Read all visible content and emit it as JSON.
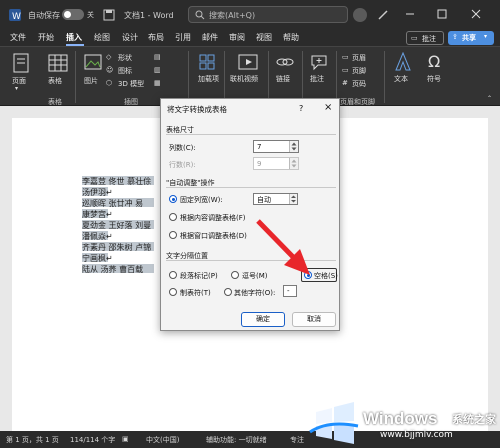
{
  "titlebar": {
    "autosave": "自动保存",
    "toggle_state": "关",
    "doc_title": "文档1 - Word",
    "search_placeholder": "搜索(Alt+Q)"
  },
  "menu": {
    "items": [
      "文件",
      "开始",
      "插入",
      "绘图",
      "设计",
      "布局",
      "引用",
      "邮件",
      "审阅",
      "视图",
      "帮助"
    ],
    "active": "插入",
    "comment": "批注",
    "share": "共享"
  },
  "ribbon": {
    "page_btn": "页面",
    "table_btn": "表格",
    "picture_btn": "图片",
    "shapes": "形状",
    "icons": "图标",
    "model3d": "3D 模型",
    "addins": "加载项",
    "online_video": "联机视频",
    "link": "链接",
    "comment_btn": "批注",
    "header": "页眉",
    "footer": "页脚",
    "pagenum": "页码",
    "textbox": "文本",
    "symbol": "符号",
    "group_table": "表格",
    "group_illus": "插图",
    "group_hf": "页眉和页脚"
  },
  "doc": {
    "lines": [
      "李嘉荳  佟世  慕壮俆",
      "汤伊羽↵",
      "巡顺晖  张廿冲  易",
      "康梦宫↵",
      "夏劲金  王好落  刘曼",
      "潘佩焱↵",
      "齐素丹  邵朱树  卢锦",
      "宁画枫↵",
      "陆从  汤荞  曹百载"
    ]
  },
  "dialog": {
    "title": "将文字转换成表格",
    "help": "?",
    "close": "×",
    "size_section": "表格尺寸",
    "cols_label": "列数(C):",
    "cols_value": "7",
    "rows_label": "行数(R):",
    "rows_value": "9",
    "autofit_section": "\"自动调整\"操作",
    "fixed_width": "固定列宽(W):",
    "autofit_value": "自动",
    "fit_content": "根据内容调整表格(F)",
    "fit_window": "根据窗口调整表格(D)",
    "sep_section": "文字分隔位置",
    "para_mark": "段落标记(P)",
    "comma": "逗号(M)",
    "space": "空格(S)",
    "tab": "制表符(T)",
    "other": "其他字符(O):",
    "other_value": "-",
    "ok": "确定",
    "cancel": "取消"
  },
  "status": {
    "page": "第 1 页，共 1 页",
    "words": "114/114 个字",
    "lang": "中文(中国)",
    "accessibility": "辅助功能: 一切就绪",
    "focus": "专注"
  },
  "watermark": {
    "brand": "Windows",
    "site": "系统之家",
    "url": "www.bjjmlv.com"
  },
  "colors": {
    "titlebar": "#2b2b2b",
    "ribbon": "#333333",
    "accent": "#0b57d0",
    "arrow": "#e8262b",
    "selection": "#bfc7cf"
  }
}
